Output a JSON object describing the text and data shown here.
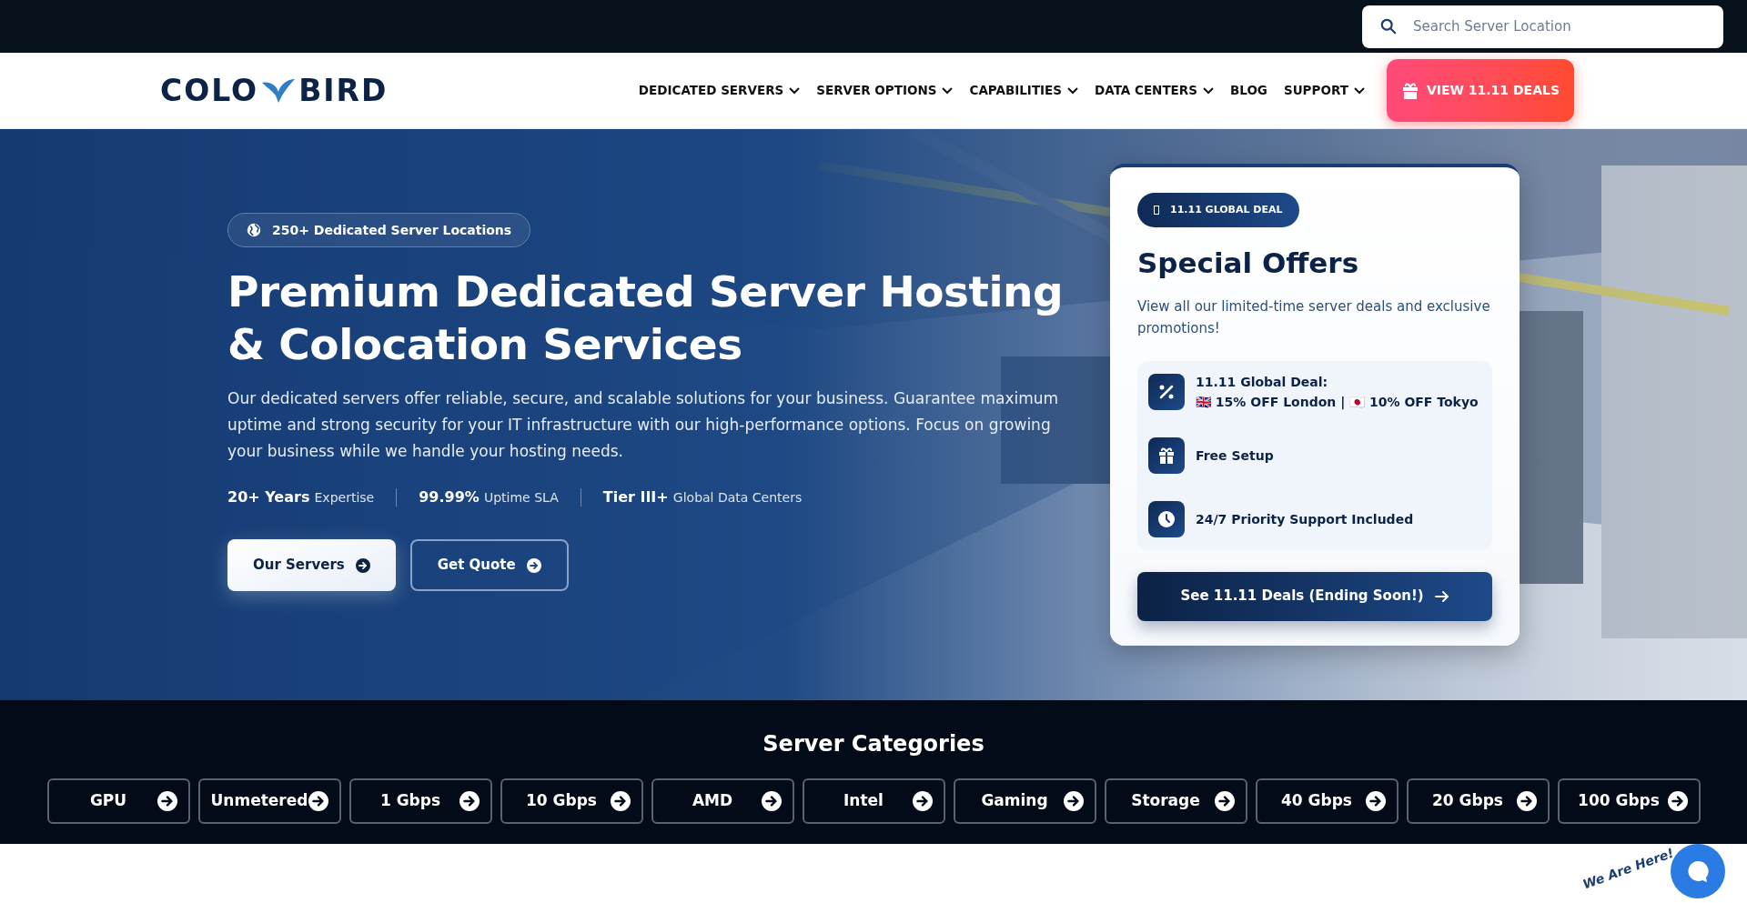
{
  "search": {
    "placeholder": "Search Server Location"
  },
  "logo": {
    "left": "COLO",
    "right": "BIRD"
  },
  "nav": [
    {
      "label": "DEDICATED SERVERS",
      "dropdown": true
    },
    {
      "label": "SERVER OPTIONS",
      "dropdown": true
    },
    {
      "label": "CAPABILITIES",
      "dropdown": true
    },
    {
      "label": "DATA CENTERS",
      "dropdown": true
    },
    {
      "label": "BLOG",
      "dropdown": false
    },
    {
      "label": "SUPPORT",
      "dropdown": true
    }
  ],
  "deals_button": "VIEW 11.11 DEALS",
  "hero": {
    "badge": "250+ Dedicated Server Locations",
    "title": [
      "Premium Dedicated Server Hosting",
      "& Colocation Services"
    ],
    "description": "Our dedicated servers offer reliable, secure, and scalable solutions for your business. Guarantee maximum uptime and strong security for your IT infrastructure with our high-performance options. Focus on growing your business while we handle your hosting needs.",
    "stats": [
      {
        "value": "20+ Years",
        "label": "Expertise"
      },
      {
        "value": "99.99%",
        "label": "Uptime SLA"
      },
      {
        "value": "Tier III+",
        "label": "Global Data Centers"
      }
    ],
    "buttons": [
      {
        "label": "Our Servers",
        "kind": "primary"
      },
      {
        "label": "Get Quote",
        "kind": "outline"
      }
    ]
  },
  "offer_card": {
    "badge": "11.11 GLOBAL DEAL",
    "title": "Special Offers",
    "description": "View all our limited-time server deals and exclusive promotions!",
    "items": [
      {
        "kind": "percent",
        "lines": [
          "11.11 Global Deal:",
          "🇬🇧 15% OFF London | 🇯🇵 10% OFF Tokyo"
        ]
      },
      {
        "kind": "gift",
        "lines": [
          "Free Setup"
        ]
      },
      {
        "kind": "clock",
        "lines": [
          "24/7 Priority Support Included"
        ]
      }
    ],
    "cta": "See 11.11 Deals (Ending Soon!)"
  },
  "categories": {
    "title": "Server Categories",
    "items": [
      "GPU",
      "Unmetered",
      "1 Gbps",
      "10 Gbps",
      "AMD",
      "Intel",
      "Gaming",
      "Storage",
      "40 Gbps",
      "20 Gbps",
      "100 Gbps"
    ]
  },
  "chat": {
    "label": "We Are Here!"
  }
}
